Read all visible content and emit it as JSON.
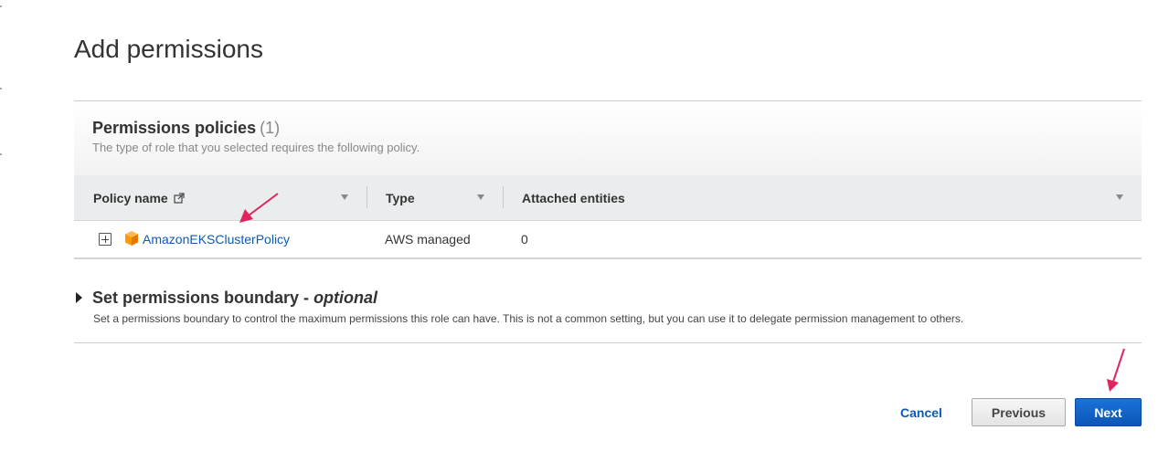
{
  "page": {
    "title": "Add permissions"
  },
  "permissions_policies": {
    "title": "Permissions policies",
    "count": "(1)",
    "description": "The type of role that you selected requires the following policy.",
    "columns": {
      "policy_name": "Policy name",
      "type": "Type",
      "attached_entities": "Attached entities"
    },
    "rows": [
      {
        "policy_name": "AmazonEKSClusterPolicy",
        "type": "AWS managed",
        "attached_entities": "0"
      }
    ]
  },
  "permissions_boundary": {
    "title": "Set permissions boundary - ",
    "title_optional": "optional",
    "description": "Set a permissions boundary to control the maximum permissions this role can have. This is not a common setting, but you can use it to delegate permission management to others."
  },
  "footer": {
    "cancel_label": "Cancel",
    "previous_label": "Previous",
    "next_label": "Next"
  },
  "colors": {
    "link": "#0a5bb5",
    "primary_button": "#0b56b8",
    "annotation_arrow": "#e0245e",
    "aws_icon": "#f90"
  },
  "icons": {
    "external_link": "external-link-icon",
    "expand": "plus-square-icon",
    "policy_type": "aws-cube-icon",
    "sort": "caret-down-icon",
    "boundary_toggle": "triangle-right-icon"
  }
}
